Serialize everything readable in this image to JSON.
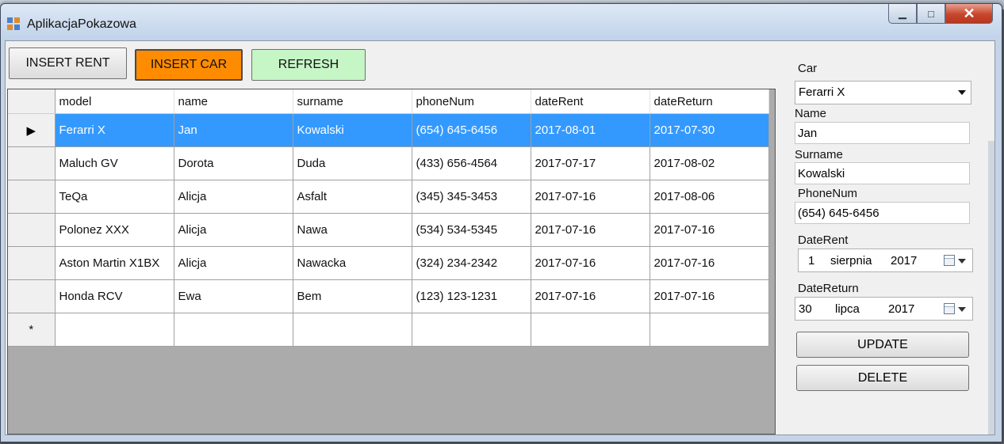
{
  "window": {
    "title": "AplikacjaPokazowa"
  },
  "toolbar": {
    "insert_rent": "INSERT RENT",
    "insert_car": "INSERT CAR",
    "refresh": "REFRESH"
  },
  "colors": {
    "insert_car_bg": "#ff8c00",
    "refresh_bg": "#c6f5c6",
    "selection": "#3399ff"
  },
  "grid": {
    "columns": [
      "model",
      "name",
      "surname",
      "phoneNum",
      "dateRent",
      "dateReturn"
    ],
    "rows": [
      [
        "Ferarri X",
        "Jan",
        "Kowalski",
        "(654) 645-6456",
        "2017-08-01",
        "2017-07-30"
      ],
      [
        "Maluch GV",
        "Dorota",
        "Duda",
        "(433) 656-4564",
        "2017-07-17",
        "2017-08-02"
      ],
      [
        "TeQa",
        "Alicja",
        "Asfalt",
        "(345) 345-3453",
        "2017-07-16",
        "2017-08-06"
      ],
      [
        "Polonez XXX",
        "Alicja",
        "Nawa",
        "(534) 534-5345",
        "2017-07-16",
        "2017-07-16"
      ],
      [
        "Aston Martin X1BX",
        "Alicja",
        "Nawacka",
        "(324) 234-2342",
        "2017-07-16",
        "2017-07-16"
      ],
      [
        "Honda RCV",
        "Ewa",
        "Bem",
        "(123) 123-1231",
        "2017-07-16",
        "2017-07-16"
      ]
    ],
    "new_row_marker": "*",
    "current_row_marker": "▶"
  },
  "form": {
    "car_label": "Car",
    "car_value": "Ferarri X",
    "name_label": "Name",
    "name_value": "Jan",
    "surname_label": "Surname",
    "surname_value": "Kowalski",
    "phone_label": "PhoneNum",
    "phone_value": "(654) 645-6456",
    "date_rent_label": "DateRent",
    "date_rent": {
      "day": "1",
      "month": "sierpnia",
      "year": "2017"
    },
    "date_return_label": "DateReturn",
    "date_return": {
      "day": "30",
      "month": "lipca",
      "year": "2017"
    },
    "update": "UPDATE",
    "delete": "DELETE"
  }
}
